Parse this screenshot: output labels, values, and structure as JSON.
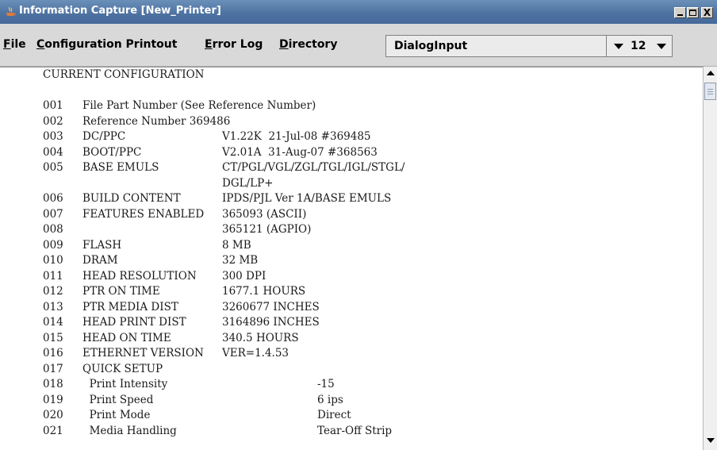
{
  "window": {
    "title": "Information Capture [New_Printer]",
    "close_glyph": "X"
  },
  "menu": {
    "items": [
      {
        "mnemonic": "F",
        "rest": "ile"
      },
      {
        "mnemonic": "C",
        "rest": "onfiguration Printout"
      },
      {
        "mnemonic": "E",
        "rest": "rror Log"
      },
      {
        "mnemonic": "D",
        "rest": "irectory"
      }
    ],
    "font_select": "DialogInput",
    "size_select": "12"
  },
  "config": {
    "heading": "CURRENT CONFIGURATION",
    "lines": [
      {
        "num": "001",
        "label": "File Part Number (See Reference Number)",
        "value": ""
      },
      {
        "num": "002",
        "label": "Reference Number 369486",
        "value": ""
      },
      {
        "num": "003",
        "label": "DC/PPC",
        "value": "V1.22K  21-Jul-08 #369485"
      },
      {
        "num": "004",
        "label": "BOOT/PPC",
        "value": "V2.01A  31-Aug-07 #368563"
      },
      {
        "num": "005",
        "label": "BASE EMULS",
        "value": "CT/PGL/VGL/ZGL/TGL/IGL/STGL/"
      },
      {
        "num": "",
        "label": "",
        "value": "DGL/LP+"
      },
      {
        "num": "006",
        "label": "BUILD CONTENT",
        "value": "IPDS/PJL Ver 1A/BASE EMULS"
      },
      {
        "num": "007",
        "label": "FEATURES ENABLED",
        "value": "365093 (ASCII)"
      },
      {
        "num": "008",
        "label": "",
        "value": "365121 (AGPIO)"
      },
      {
        "num": "009",
        "label": "FLASH",
        "value": "8 MB"
      },
      {
        "num": "010",
        "label": "DRAM",
        "value": "32 MB"
      },
      {
        "num": "011",
        "label": "HEAD RESOLUTION",
        "value": "300 DPI"
      },
      {
        "num": "012",
        "label": "PTR ON TIME",
        "value": "1677.1 HOURS"
      },
      {
        "num": "013",
        "label": "PTR MEDIA DIST",
        "value": "3260677 INCHES"
      },
      {
        "num": "014",
        "label": "HEAD PRINT DIST",
        "value": "3164896 INCHES"
      },
      {
        "num": "015",
        "label": "HEAD ON TIME",
        "value": "340.5 HOURS"
      },
      {
        "num": "016",
        "label": "ETHERNET VERSION",
        "value": "VER=1.4.53"
      },
      {
        "num": "017",
        "label": "QUICK SETUP",
        "value": ""
      }
    ],
    "sub_lines": [
      {
        "num": "018",
        "label": "  Print Intensity",
        "value": "-15"
      },
      {
        "num": "019",
        "label": "  Print Speed",
        "value": "6 ips"
      },
      {
        "num": "020",
        "label": "  Print Mode",
        "value": "Direct"
      },
      {
        "num": "021",
        "label": "  Media Handling",
        "value": "Tear-Off Strip"
      }
    ]
  }
}
